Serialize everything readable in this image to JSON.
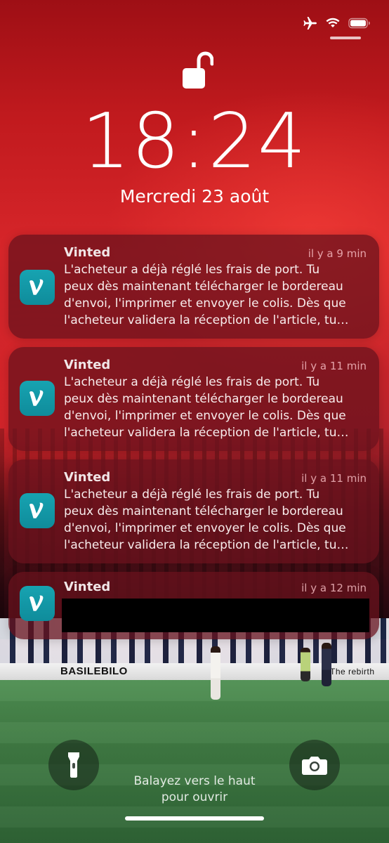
{
  "clock": {
    "time": "18:24",
    "date": "Mercredi 23 août"
  },
  "notifications": [
    {
      "app": "Vinted",
      "time": "il y a 9 min",
      "lines": [
        "L'acheteur a déjà réglé les frais de port. Tu",
        "peux dès maintenant télécharger le bordereau",
        "d'envoi, l'imprimer et envoyer le colis. Dès que",
        "l'acheteur validera la réception de l'article, tu…"
      ]
    },
    {
      "app": "Vinted",
      "time": "il y a 11 min",
      "lines": [
        "L'acheteur a déjà réglé les frais de port. Tu",
        "peux dès maintenant télécharger le bordereau",
        "d'envoi, l'imprimer et envoyer le colis. Dès que",
        "l'acheteur validera la réception de l'article, tu…"
      ]
    },
    {
      "app": "Vinted",
      "time": "il y a 11 min",
      "lines": [
        "L'acheteur a déjà réglé les frais de port. Tu",
        "peux dès maintenant télécharger le bordereau",
        "d'envoi, l'imprimer et envoyer le colis. Dès que",
        "l'acheteur validera la réception de l'article, tu…"
      ]
    },
    {
      "app": "Vinted",
      "time": "il y a 12 min",
      "redacted": true
    }
  ],
  "app_icon_letter": "V",
  "wallpaper": {
    "adboard_left": "BASILEBILO",
    "adboard_right": "The rebirth"
  },
  "bottom": {
    "swipe_hint_line1": "Balayez vers le haut",
    "swipe_hint_line2": "pour ouvrir"
  },
  "icons": {
    "status": [
      "airplane-icon",
      "wifi-icon",
      "battery-icon"
    ],
    "lock": "unlocked-padlock-icon",
    "left_button": "flashlight-icon",
    "right_button": "camera-icon"
  },
  "colors": {
    "vinted_teal": "#14a0ae",
    "notification_bg": "#68121c"
  }
}
